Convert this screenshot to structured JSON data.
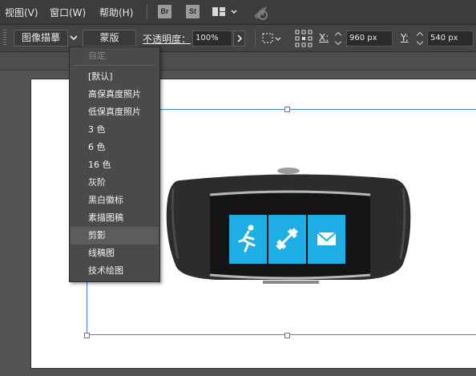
{
  "menubar": {
    "view": "视图(V)",
    "window": "窗口(W)",
    "help": "帮助(H)",
    "bridge_badge": "Br",
    "stock_badge": "St"
  },
  "controlbar": {
    "trace_button": "图像描摹",
    "mask_button": "蒙版",
    "opacity_label": "不透明度：",
    "opacity_value": "100%",
    "x_label": "X:",
    "x_value": "960 px",
    "y_label": "Y:",
    "y_value": "540 px"
  },
  "trace_presets": {
    "items": [
      {
        "label": "自定",
        "state": "disabled"
      },
      {
        "label": "[默认]",
        "state": "normal"
      },
      {
        "label": "高保真度照片",
        "state": "normal"
      },
      {
        "label": "低保真度照片",
        "state": "normal"
      },
      {
        "label": "3 色",
        "state": "normal"
      },
      {
        "label": "6 色",
        "state": "normal"
      },
      {
        "label": "16 色",
        "state": "normal"
      },
      {
        "label": "灰阶",
        "state": "normal"
      },
      {
        "label": "黑白徽标",
        "state": "normal"
      },
      {
        "label": "素描图稿",
        "state": "normal"
      },
      {
        "label": "剪影",
        "state": "highlighted"
      },
      {
        "label": "线稿图",
        "state": "normal"
      },
      {
        "label": "技术绘图",
        "state": "normal"
      }
    ]
  },
  "colors": {
    "selection": "#3b7dd8",
    "tile": "#1eaee6",
    "band": "#2c2c2c"
  },
  "icons": {
    "tiles": [
      "runner-icon",
      "dumbbell-icon",
      "mail-icon"
    ]
  }
}
